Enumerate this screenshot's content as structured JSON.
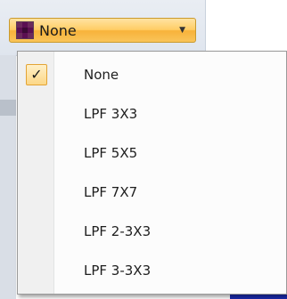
{
  "combo": {
    "selected_label": "None",
    "icon": "filter-grid-icon",
    "arrow_icon": "chevron-down-icon",
    "icon_colors": [
      "#6b2a5c",
      "#5b0f52",
      "#6b2a5c",
      "#5b0f52",
      "#3a0a35",
      "#5b0f52",
      "#6b2a5c",
      "#5b0f52",
      "#6b2a5c"
    ]
  },
  "menu": {
    "items": [
      {
        "label": "None",
        "checked": true
      },
      {
        "label": "LPF 3X3",
        "checked": false
      },
      {
        "label": "LPF 5X5",
        "checked": false
      },
      {
        "label": "LPF 7X7",
        "checked": false
      },
      {
        "label": "LPF 2-3X3",
        "checked": false
      },
      {
        "label": "LPF 3-3X3",
        "checked": false
      }
    ]
  },
  "colors": {
    "accent_orange": "#f8b23a",
    "check_border": "#e3a435"
  }
}
